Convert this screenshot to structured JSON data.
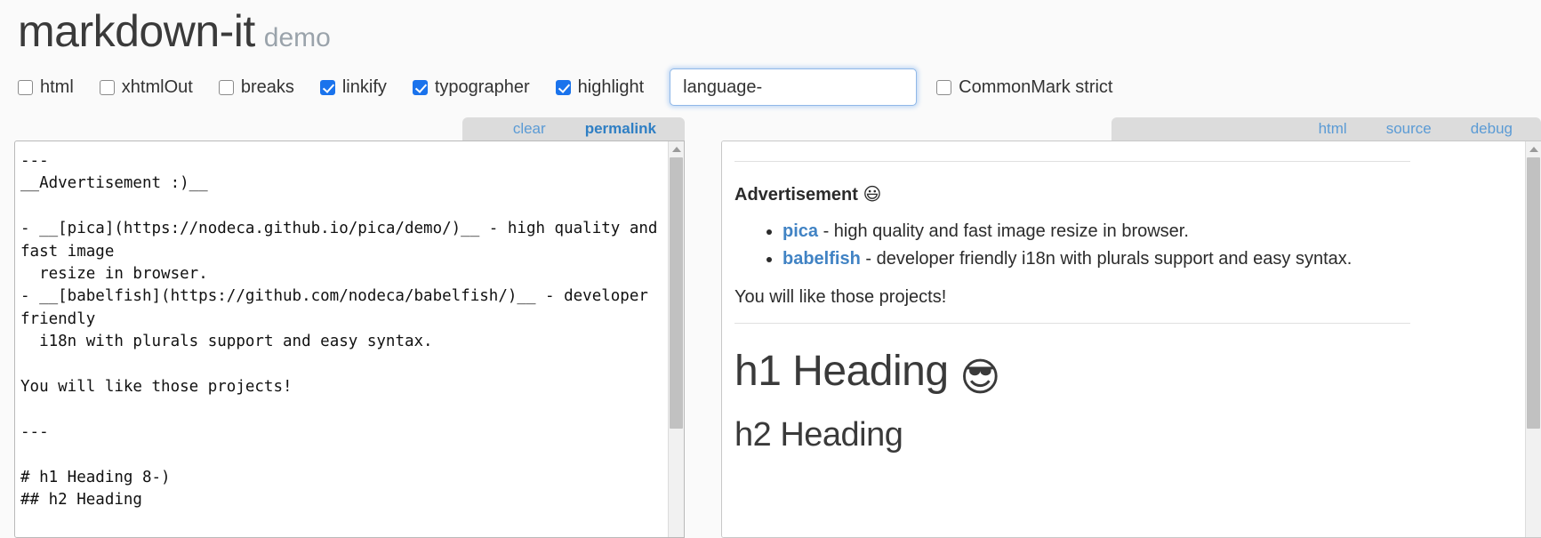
{
  "header": {
    "title": "markdown-it",
    "subtitle": "demo"
  },
  "options": [
    {
      "label": "html",
      "checked": false,
      "name": "option-html"
    },
    {
      "label": "xhtmlOut",
      "checked": false,
      "name": "option-xhtmlout"
    },
    {
      "label": "breaks",
      "checked": false,
      "name": "option-breaks"
    },
    {
      "label": "linkify",
      "checked": true,
      "name": "option-linkify"
    },
    {
      "label": "typographer",
      "checked": true,
      "name": "option-typographer"
    },
    {
      "label": "highlight",
      "checked": true,
      "name": "option-highlight"
    }
  ],
  "language_prefix": {
    "value": "language-",
    "placeholder": "language-"
  },
  "commonmark": {
    "label": "CommonMark strict",
    "checked": false
  },
  "left_tabs": [
    {
      "label": "clear",
      "active": false
    },
    {
      "label": "permalink",
      "active": true
    }
  ],
  "right_tabs": [
    {
      "label": "html",
      "active": false
    },
    {
      "label": "source",
      "active": false
    },
    {
      "label": "debug",
      "active": false
    }
  ],
  "source": {
    "text": "---\n__Advertisement :)__\n\n- __[pica](https://nodeca.github.io/pica/demo/)__ - high quality and fast image\n  resize in browser.\n- __[babelfish](https://github.com/nodeca/babelfish/)__ - developer friendly\n  i18n with plurals support and easy syntax.\n\nYou will like those projects!\n\n---\n\n# h1 Heading 8-)\n## h2 Heading"
  },
  "preview": {
    "advertisement": {
      "label": "Advertisement",
      "emoji": "😃"
    },
    "list": [
      {
        "link": "pica",
        "rest": " - high quality and fast image resize in browser."
      },
      {
        "link": "babelfish",
        "rest": " - developer friendly i18n with plurals support and easy syntax."
      }
    ],
    "outro": "You will like those projects!",
    "h1": "h1 Heading",
    "h1_emoji": "😎",
    "h2": "h2 Heading"
  },
  "colors": {
    "accent_blue": "#1a73ec",
    "link_blue": "#4183c4",
    "tab_blue": "#5b9bd5",
    "tab_active_blue": "#2f7fc4",
    "tabbar_gray": "#dcdcdc",
    "page_bg": "#fafafa"
  }
}
